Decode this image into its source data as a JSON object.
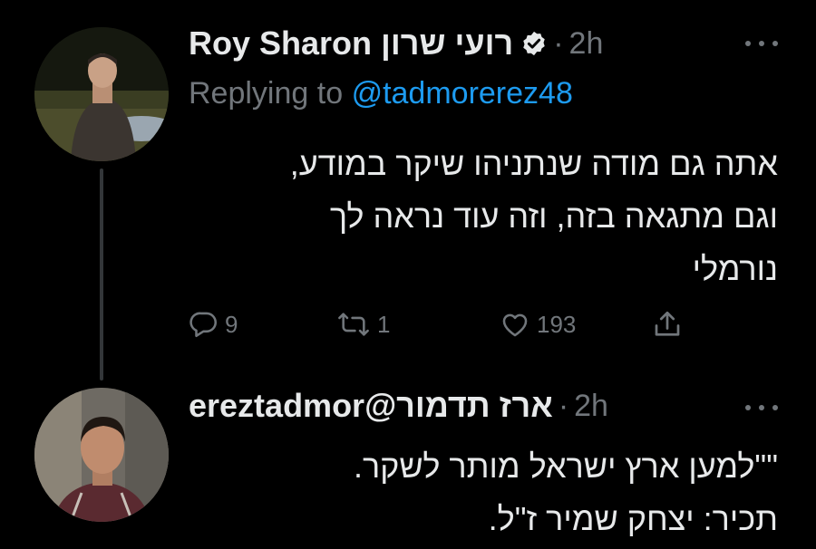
{
  "tweets": [
    {
      "name": "Roy Sharon",
      "name_he": "רועי שרון",
      "verified": true,
      "dot": "·",
      "time": "2h",
      "replying_prefix": "Replying to",
      "replying_handle": "@tadmorerez48",
      "text_lines": [
        "אתה גם מודה שנתניהו שיקר במודע,",
        "וגם מתגאה בזה, וזה עוד נראה לך",
        "נורמלי"
      ],
      "actions": {
        "replies": "9",
        "retweets": "1",
        "likes": "193"
      }
    },
    {
      "name": "ereztadmor@ארז תדמור",
      "dot": "·",
      "time": "2h",
      "text_lines": [
        "\"\"למען ארץ ישראל מותר לשקר.",
        "תכיר: יצחק שמיר ז\"ל."
      ]
    }
  ],
  "colors": {
    "background": "#000000",
    "text": "#e7e9ea",
    "muted": "#71767b",
    "link": "#1d9bf0",
    "thread_line": "#333639"
  },
  "icons": [
    "verified-badge-icon",
    "more-icon",
    "reply-icon",
    "retweet-icon",
    "like-icon",
    "share-icon"
  ]
}
